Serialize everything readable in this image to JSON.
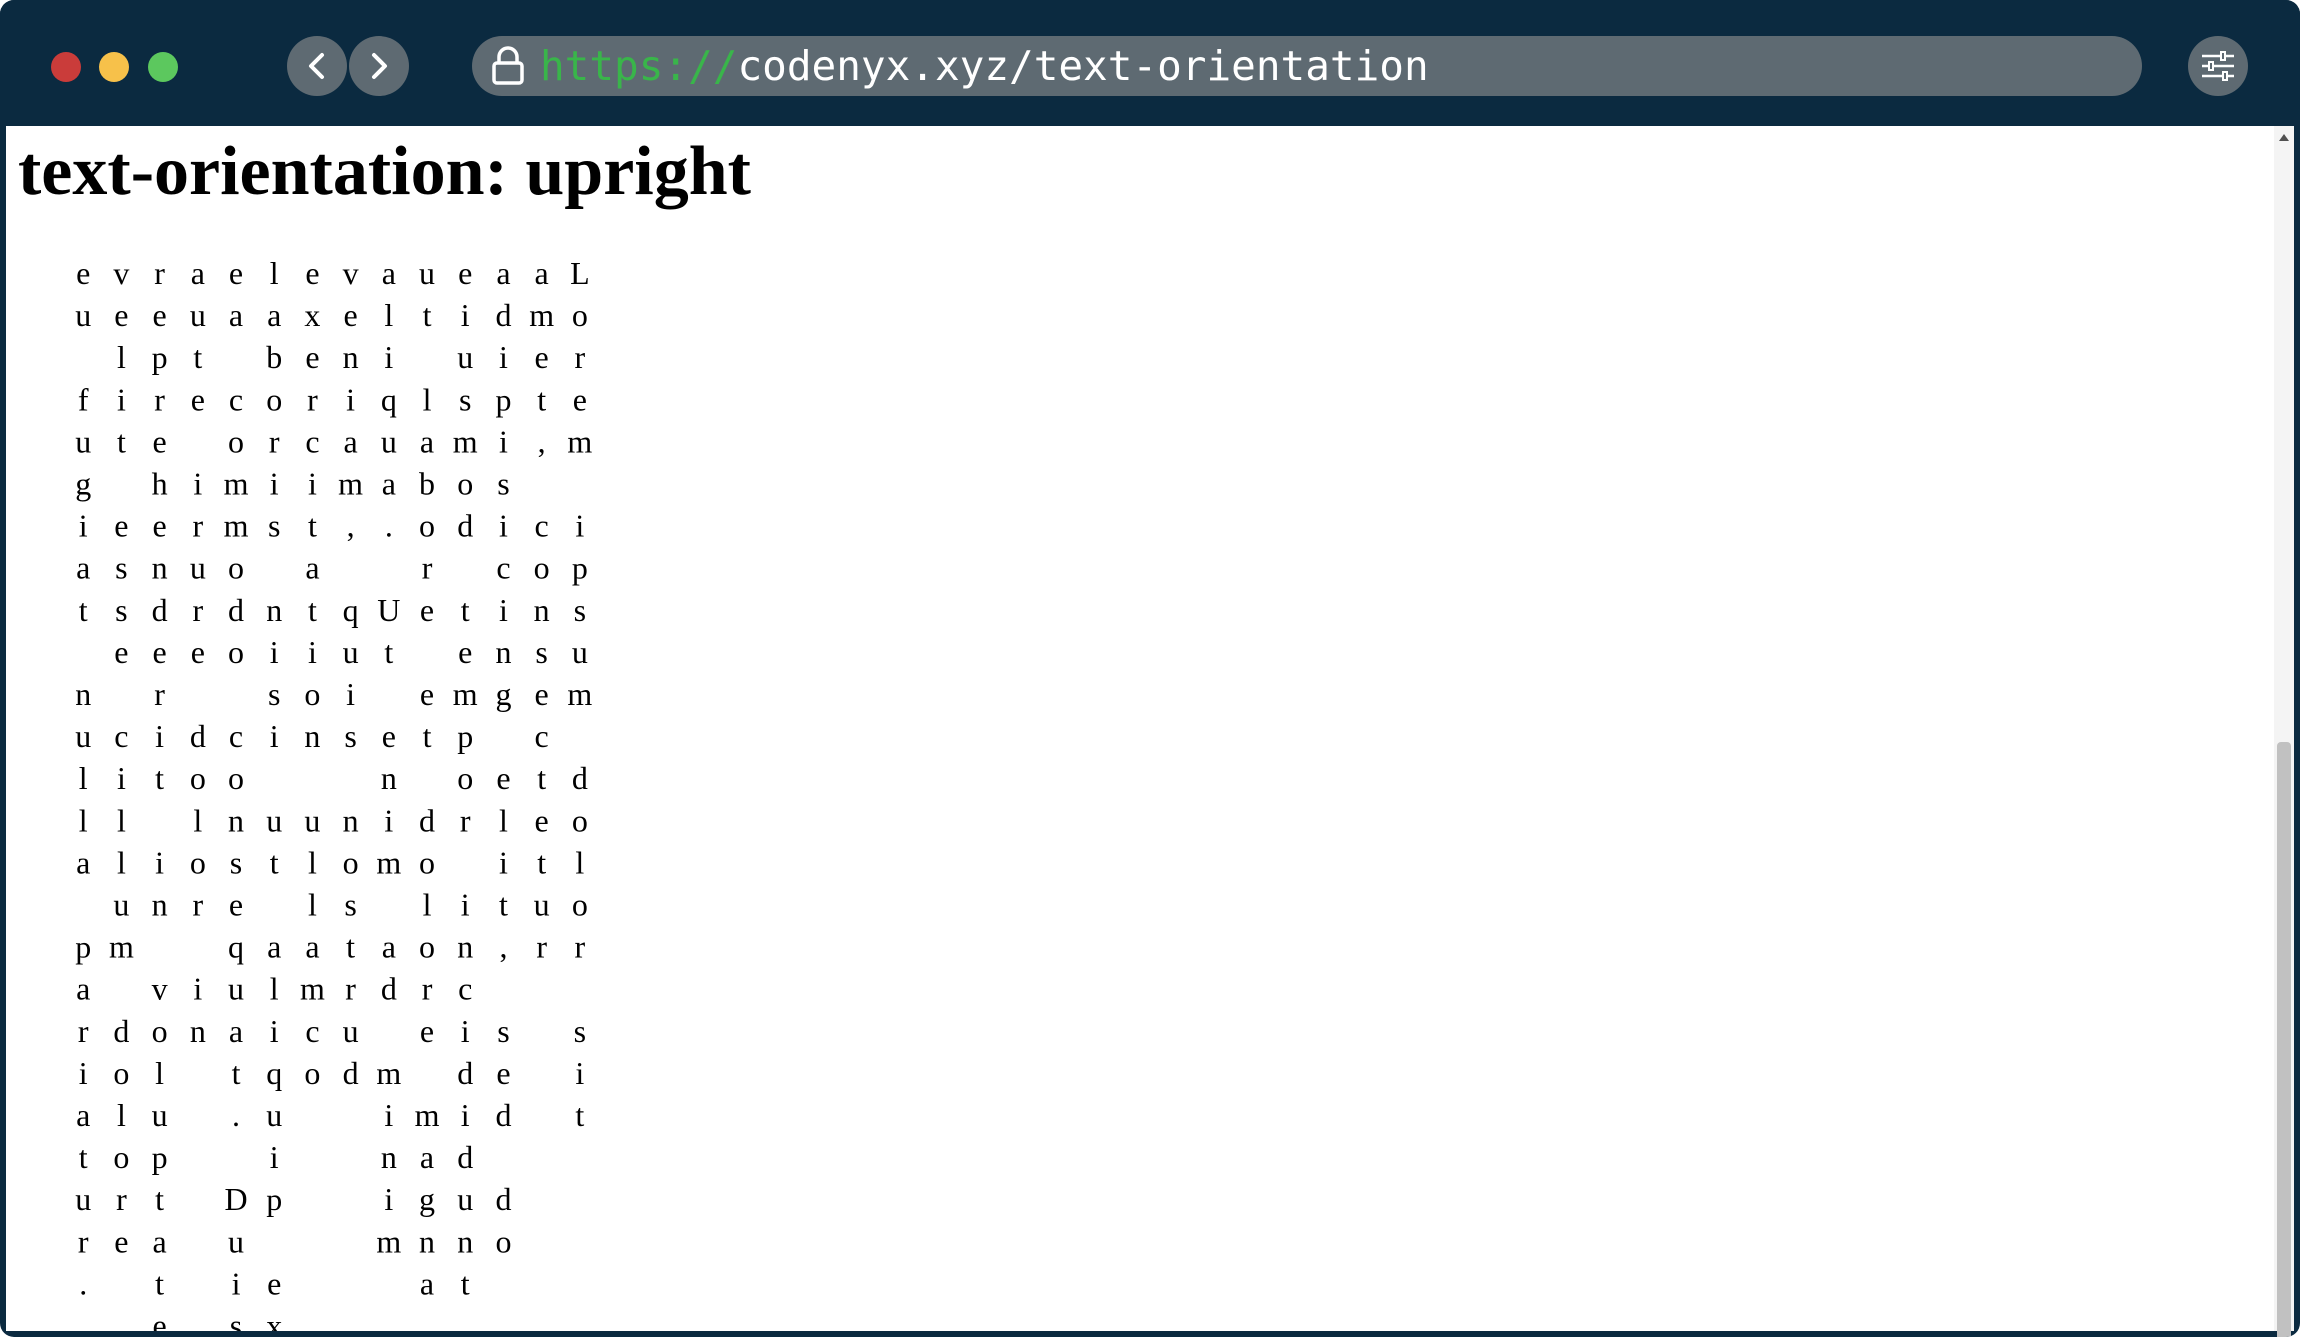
{
  "browser": {
    "url_scheme": "https://",
    "url_host": "codenyx.xyz/text-orientation",
    "back_icon": "chevron-left-icon",
    "forward_icon": "chevron-right-icon",
    "lock_icon": "lock-icon",
    "menu_icon": "sliders-icon"
  },
  "page": {
    "heading": "text-orientation: upright",
    "vertical_text": "Lorem ipsum dolor sit amet, consectetur adipisicing elit, sed do eiusmod tempor incididunt ut labore et dolore magna aliqua. Ut enim ad minim veniam, quis nostrud exercitation ullamco laboris nisi ut aliquip ex ea commodo consequat. Duis aute irure dolor in reprehenderit in voluptate velit esse cillum dolore eu fugiat nulla pariatur."
  },
  "colors": {
    "titlebar": "#0b2a40",
    "close": "#ca3c3a",
    "minimize": "#f7c14a",
    "zoom": "#5cc85e",
    "url_scheme": "#39b54a"
  }
}
